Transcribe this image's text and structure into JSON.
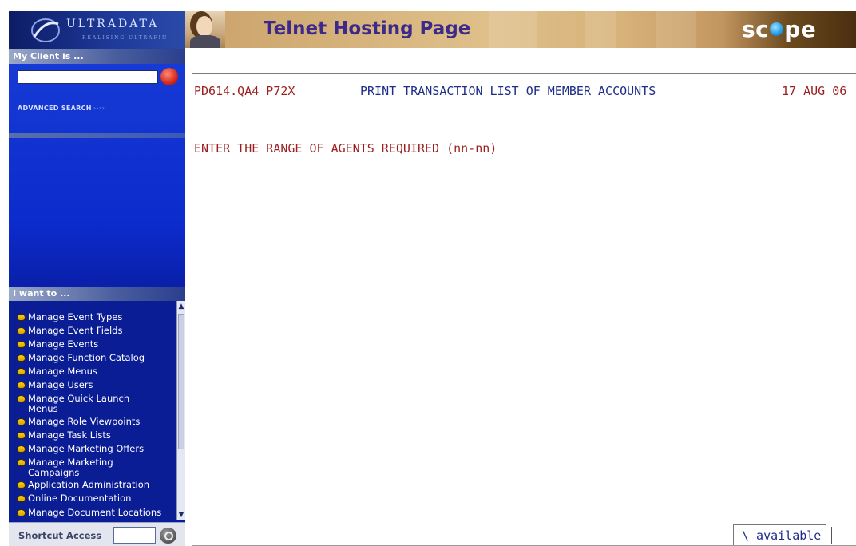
{
  "sidebar": {
    "logo": {
      "name": "ULTRADATA",
      "tagline": "REALISING ULTRAFIN"
    },
    "client_section": {
      "title": "My Client is ...",
      "search_value": "",
      "search_icon": "search-icon",
      "advanced_search_label": "ADVANCED SEARCH",
      "advanced_search_arrows": "››››"
    },
    "iwant_section": {
      "title": "I want to ...",
      "items": [
        {
          "label": "Manage Event Types"
        },
        {
          "label": "Manage Event Fields"
        },
        {
          "label": "Manage Events"
        },
        {
          "label": "Manage Function Catalog"
        },
        {
          "label": "Manage Menus"
        },
        {
          "label": "Manage Users"
        },
        {
          "label": "Manage Quick Launch Menus"
        },
        {
          "label": "Manage Role Viewpoints"
        },
        {
          "label": "Manage Task Lists"
        },
        {
          "label": "Manage Marketing Offers"
        },
        {
          "label": "Manage Marketing Campaigns"
        },
        {
          "label": "Application Administration"
        },
        {
          "label": "Online Documentation"
        },
        {
          "label": "Manage Document Locations"
        }
      ],
      "scroll_up": "▲",
      "scroll_down": "▼"
    },
    "shortcut": {
      "label": "Shortcut Access",
      "value": ""
    }
  },
  "header": {
    "title": "Telnet Hosting Page",
    "brand_left": "sc",
    "brand_right": "pe"
  },
  "terminal": {
    "program_id": "PD614.QA4 P72X",
    "screen_title": "PRINT TRANSACTION LIST OF MEMBER ACCOUNTS",
    "date": "17 AUG 06",
    "prompt": "ENTER THE RANGE OF AGENTS REQUIRED (nn-nn)",
    "status": "\\ available"
  },
  "colors": {
    "sidebar_blue": "#0c2bcc",
    "terminal_red": "#9b1f1f",
    "terminal_blue": "#1f2d8a",
    "header_title": "#3b2a8a",
    "header_tan": "#dfc08a"
  }
}
